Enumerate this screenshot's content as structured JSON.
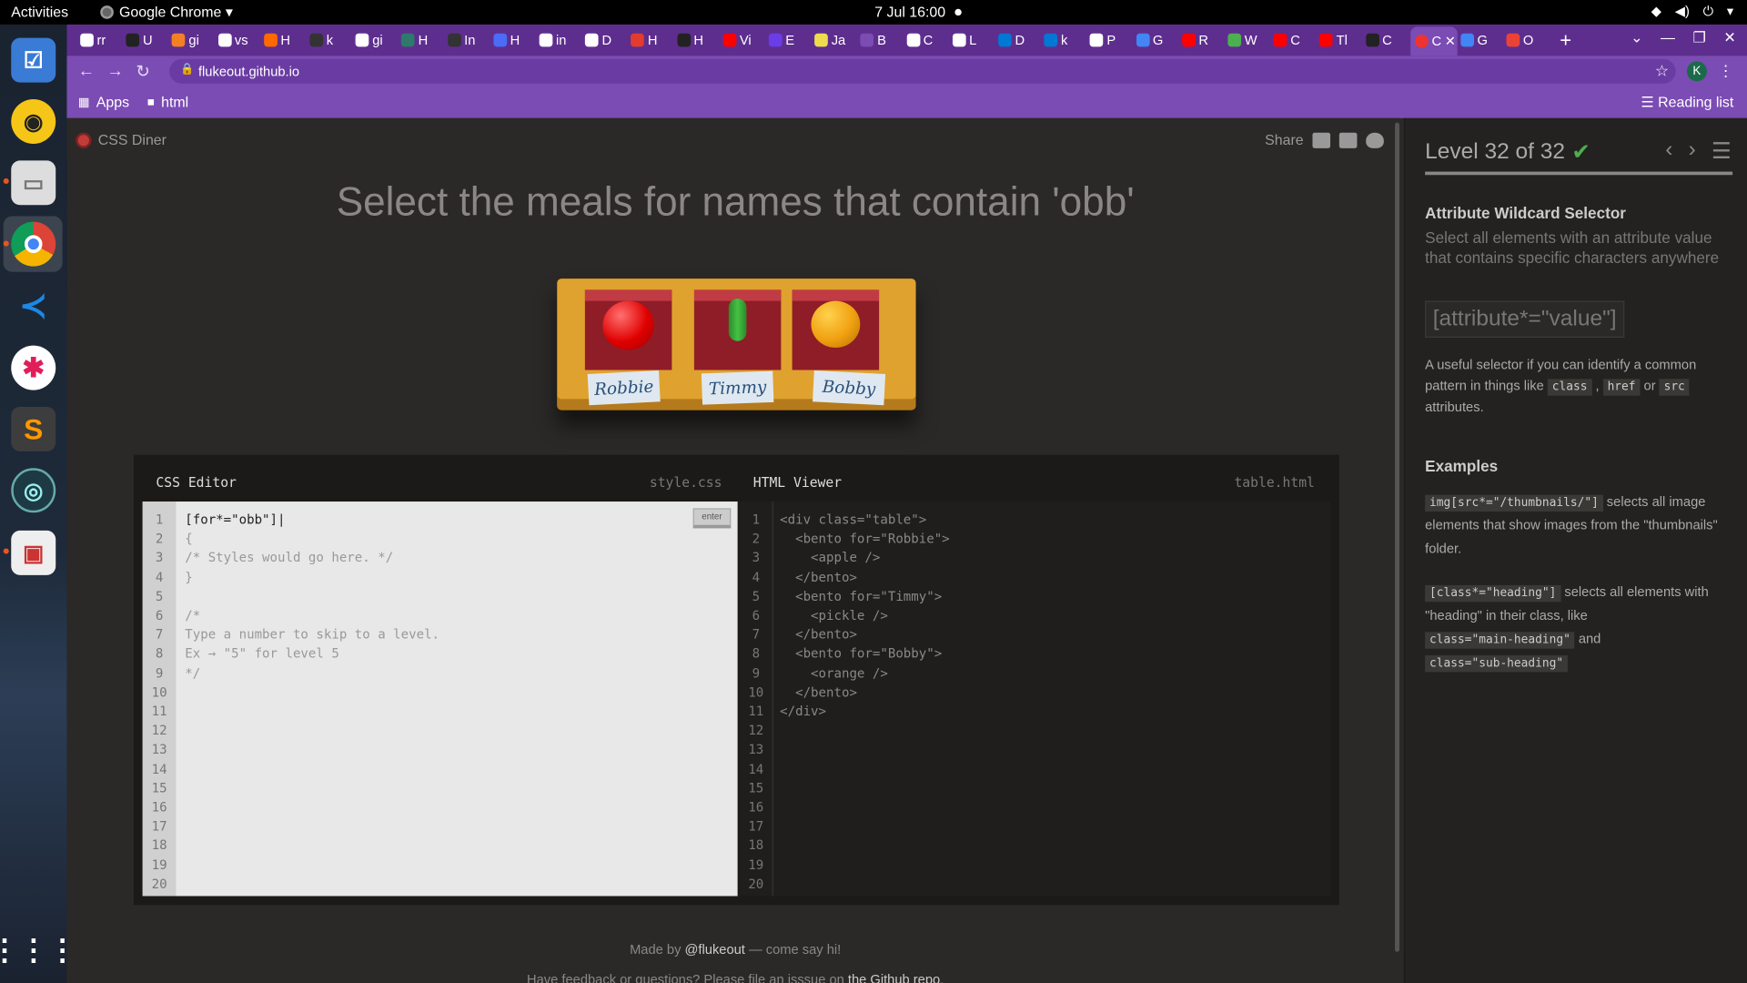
{
  "system": {
    "activities": "Activities",
    "app_menu": "Google Chrome ▾",
    "clock": "7 Jul  16:00"
  },
  "dock": {
    "items": [
      "todo-app",
      "rhythmbox",
      "files",
      "chrome",
      "vscode",
      "slack",
      "sublime-text",
      "gitkraken",
      "ebook-reader",
      "show-applications"
    ]
  },
  "browser": {
    "tabs": [
      {
        "label": "rr",
        "color": "#ffffff"
      },
      {
        "label": "U",
        "color": "#222222"
      },
      {
        "label": "gi",
        "color": "#f48024"
      },
      {
        "label": "vs",
        "color": "#ffffff"
      },
      {
        "label": "H",
        "color": "#ff6a00"
      },
      {
        "label": "k",
        "color": "#333333"
      },
      {
        "label": "gi",
        "color": "#ffffff"
      },
      {
        "label": "H",
        "color": "#2d7a6b"
      },
      {
        "label": "In",
        "color": "#333333"
      },
      {
        "label": "H",
        "color": "#4a6cf7"
      },
      {
        "label": "in",
        "color": "#ffffff"
      },
      {
        "label": "D",
        "color": "#ffffff"
      },
      {
        "label": "H",
        "color": "#e33b2e"
      },
      {
        "label": "H",
        "color": "#222222"
      },
      {
        "label": "Vi",
        "color": "#ff0000"
      },
      {
        "label": "E",
        "color": "#6a3de8"
      },
      {
        "label": "Ja",
        "color": "#f0db4f"
      },
      {
        "label": "B",
        "color": "#7b4cb3"
      },
      {
        "label": "C",
        "color": "#ffffff"
      },
      {
        "label": "L",
        "color": "#ffffff"
      },
      {
        "label": "D",
        "color": "#0078d4"
      },
      {
        "label": "k",
        "color": "#0078d4"
      },
      {
        "label": "P",
        "color": "#ffffff"
      },
      {
        "label": "G",
        "color": "#4285f4"
      },
      {
        "label": "R",
        "color": "#ff0000"
      },
      {
        "label": "W",
        "color": "#4caf50"
      },
      {
        "label": "C",
        "color": "#ff0000"
      },
      {
        "label": "Tl",
        "color": "#ff0000"
      },
      {
        "label": "C",
        "color": "#222222"
      },
      {
        "label": "G",
        "color": "#4285f4"
      },
      {
        "label": "O",
        "color": "#ea4335"
      }
    ],
    "active_tab": {
      "label": "C",
      "close": "✕"
    },
    "new_tab": "+",
    "url": "flukeout.github.io",
    "profile_initial": "K",
    "bookmarks": {
      "apps": "Apps",
      "html": "html",
      "reading_list": "Reading list"
    }
  },
  "game": {
    "logo": "CSS Diner",
    "share": "Share",
    "order": "Select the meals for names that contain 'obb'",
    "bentos": [
      {
        "name": "Robbie",
        "food": "apple"
      },
      {
        "name": "Timmy",
        "food": "pickle"
      },
      {
        "name": "Bobby",
        "food": "orange"
      }
    ],
    "css_editor": {
      "title": "CSS Editor",
      "filename": "style.css",
      "enter": "enter",
      "lines": [
        "[for*=\"obb\"]|",
        "{",
        "/* Styles would go here. */",
        "}",
        "",
        "/*",
        "Type a number to skip to a level.",
        "Ex → \"5\" for level 5",
        "*/"
      ]
    },
    "html_viewer": {
      "title": "HTML Viewer",
      "filename": "table.html",
      "lines": [
        "<div class=\"table\">",
        "  <bento for=\"Robbie\">",
        "    <apple />",
        "  </bento>",
        "  <bento for=\"Timmy\">",
        "    <pickle />",
        "  </bento>",
        "  <bento for=\"Bobby\">",
        "    <orange />",
        "  </bento>",
        "</div>"
      ]
    },
    "footer": {
      "made_by": "Made by ",
      "author": "@flukeout",
      "come": " — come say hi!",
      "feedback": "Have feedback or questions? Please file an isssue on ",
      "repo": "the Github repo",
      "end": "."
    }
  },
  "sidebar": {
    "level": "Level 32 of 32",
    "progress": 1.0,
    "selector_name": "Attribute Wildcard Selector",
    "description": "Select all elements with an attribute value that contains specific characters anywhere",
    "syntax": "[attribute*=\"value\"]",
    "hint_prefix": "A useful selector if you can identify a common pattern in things like ",
    "hint_chips": [
      "class",
      "href",
      "src"
    ],
    "hint_suffix": " attributes.",
    "examples_title": "Examples",
    "examples": [
      {
        "code": "img[src*=\"/thumbnails/\"]",
        "text": " selects all image elements that show images from the \"thumbnails\" folder."
      },
      {
        "code": "[class*=\"heading\"]",
        "text": " selects all elements with \"heading\" in their class, like ",
        "code2": "class=\"main-heading\"",
        "and": " and ",
        "code3": "class=\"sub-heading\""
      }
    ]
  }
}
